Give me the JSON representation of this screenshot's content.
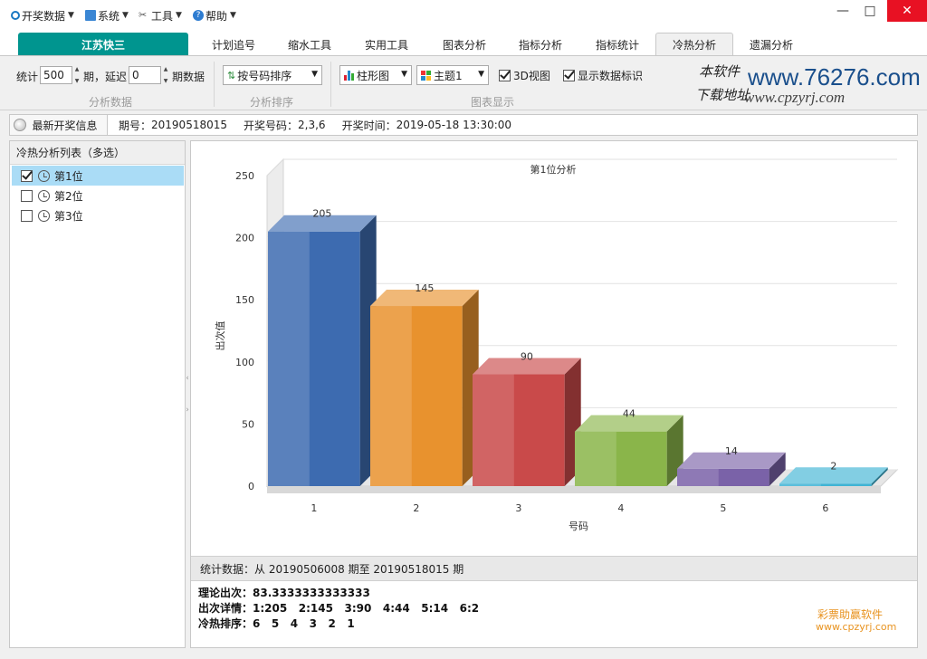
{
  "menu": {
    "items": [
      {
        "label": "开奖数据",
        "icon": "circle-icon"
      },
      {
        "label": "系统",
        "icon": "monitor-icon"
      },
      {
        "label": "工具",
        "icon": "tools-icon"
      },
      {
        "label": "帮助",
        "icon": "help-icon"
      }
    ],
    "window_buttons": {
      "minimize": "—",
      "maximize": "□",
      "close": "✕"
    }
  },
  "tabs": {
    "main": "江苏快三",
    "items": [
      "计划追号",
      "缩水工具",
      "实用工具",
      "图表分析",
      "指标分析",
      "指标统计",
      "冷热分析",
      "遗漏分析"
    ],
    "active": "冷热分析"
  },
  "toolbar": {
    "stat_label": "统计",
    "stat_value": "500",
    "period_delay_label": "期，延迟",
    "delay_value": "0",
    "period_data_label": "期数据",
    "group1_caption": "分析数据",
    "sort_select": "按号码排序",
    "group2_caption": "分析排序",
    "chart_type_select": "柱形图",
    "theme_select": "主题1",
    "view3d_label": "3D视图",
    "view3d_checked": true,
    "show_labels_label": "显示数据标识",
    "show_labels_checked": true,
    "group3_caption": "图表显示"
  },
  "watermark": {
    "cn_line1": "本软件",
    "cn_line2": "下载地址",
    "url1": "www.76276.com",
    "url2": "www.cpzyrj.com"
  },
  "infobar": {
    "latest_button": "最新开奖信息",
    "period_label": "期号：",
    "period_value": "20190518015",
    "numbers_label": "开奖号码：",
    "numbers_value": "2,3,6",
    "time_label": "开奖时间：",
    "time_value": "2019-05-18 13:30:00"
  },
  "left_panel": {
    "title": "冷热分析列表（多选）",
    "items": [
      {
        "label": "第1位",
        "checked": true,
        "selected": true
      },
      {
        "label": "第2位",
        "checked": false,
        "selected": false
      },
      {
        "label": "第3位",
        "checked": false,
        "selected": false
      }
    ]
  },
  "chart_data": {
    "type": "bar",
    "title": "第1位分析",
    "xlabel": "号码",
    "ylabel": "出次值",
    "categories": [
      "1",
      "2",
      "3",
      "4",
      "5",
      "6"
    ],
    "values": [
      205,
      145,
      90,
      44,
      14,
      2
    ],
    "ylim": [
      0,
      250
    ],
    "yticks": [
      0,
      50,
      100,
      150,
      200,
      250
    ],
    "grid": true,
    "view_3d": true,
    "colors": [
      "#3d6bb0",
      "#e8922e",
      "#c94a4a",
      "#8ab54a",
      "#7a62a8",
      "#3fb4d4"
    ]
  },
  "stats": {
    "header": "统计数据：从 20190506008 期至 20190518015 期",
    "theory_label": "理论出次：",
    "theory_value": "83.3333333333333",
    "detail_label": "出次详情：",
    "detail_value": "1:205   2:145   3:90   4:44   5:14   6:2",
    "rank_label": "冷热排序：",
    "rank_value": "6   5   4   3   2   1"
  },
  "footer": {
    "brand": "彩票助赢软件",
    "url": "www.cpzyrj.com"
  }
}
